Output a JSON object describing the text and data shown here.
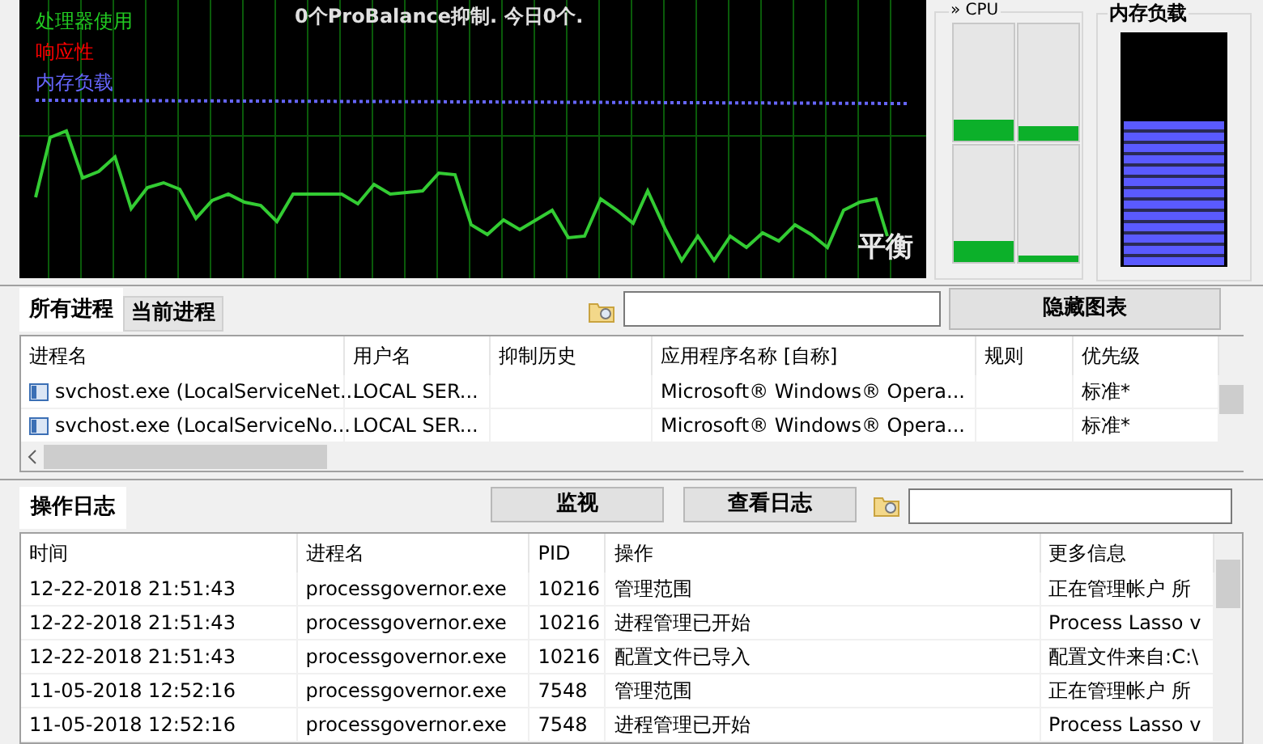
{
  "graph": {
    "legend": [
      {
        "label": "处理器使用",
        "color": "#22cc22"
      },
      {
        "label": "响应性",
        "color": "#ff0000"
      },
      {
        "label": "内存负载",
        "color": "#6666ff"
      }
    ],
    "status": "0个ProBalance抑制. 今日0个.",
    "mode": "平衡"
  },
  "cpu": {
    "title": "» CPU",
    "cores": [
      {
        "level": 0.18
      },
      {
        "level": 0.13
      },
      {
        "level": 0.18
      },
      {
        "level": 0.05
      }
    ]
  },
  "memory": {
    "title": "内存负载",
    "level": 0.62
  },
  "process_tabs": [
    {
      "label": "所有进程",
      "selected": true
    },
    {
      "label": "当前进程",
      "selected": false
    }
  ],
  "hide_graph_button": "隐藏图表",
  "process_table": {
    "columns": [
      "进程名",
      "用户名",
      "抑制历史",
      "应用程序名称 [自称]",
      "规则",
      "优先级"
    ],
    "rows": [
      [
        "svchost.exe (LocalServiceNet...",
        "LOCAL SER...",
        "",
        "Microsoft® Windows® Opera...",
        "",
        "标准*"
      ],
      [
        "svchost.exe (LocalServiceNo...",
        "LOCAL SER...",
        "",
        "Microsoft® Windows® Opera...",
        "",
        "标准*"
      ]
    ]
  },
  "log_tabs": [
    {
      "label": "操作日志",
      "selected": true
    }
  ],
  "log_buttons": [
    "监视",
    "查看日志"
  ],
  "log_table": {
    "columns": [
      "时间",
      "进程名",
      "PID",
      "操作",
      "更多信息"
    ],
    "rows": [
      [
        "12-22-2018 21:51:43",
        "processgovernor.exe",
        "10216",
        "管理范围",
        "正在管理帐户 所"
      ],
      [
        "12-22-2018 21:51:43",
        "processgovernor.exe",
        "10216",
        "进程管理已开始",
        "Process Lasso v"
      ],
      [
        "12-22-2018 21:51:43",
        "processgovernor.exe",
        "10216",
        "配置文件已导入",
        "配置文件来自:C:\\"
      ],
      [
        "11-05-2018 12:52:16",
        "processgovernor.exe",
        "7548",
        "管理范围",
        "正在管理帐户 所"
      ],
      [
        "11-05-2018 12:52:16",
        "processgovernor.exe",
        "7548",
        "进程管理已开始",
        "Process Lasso v"
      ]
    ]
  }
}
